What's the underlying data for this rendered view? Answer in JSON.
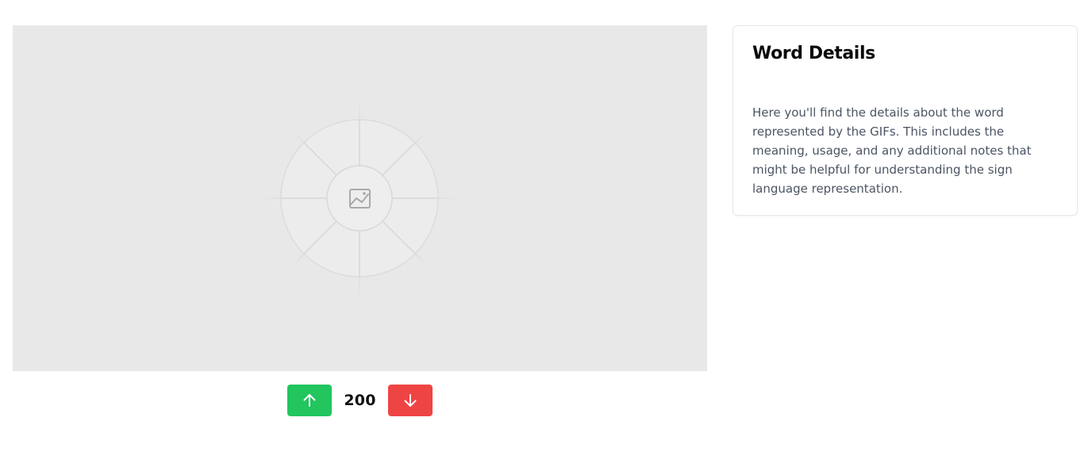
{
  "media": {
    "placeholder_icon": "image-icon",
    "background_color": "#e8e8e8"
  },
  "votes": {
    "up_icon": "arrow-up-icon",
    "down_icon": "arrow-down-icon",
    "count": "200",
    "up_color": "#22c55e",
    "down_color": "#ef4444"
  },
  "details": {
    "title": "Word Details",
    "body": "Here you'll find the details about the word represented by the GIFs. This includes the meaning, usage, and any additional notes that might be helpful for understanding the sign language representation."
  }
}
